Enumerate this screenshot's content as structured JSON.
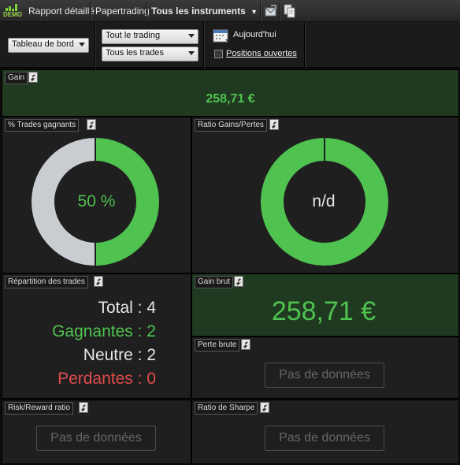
{
  "topbar": {
    "logo_text": "DEMO",
    "report_label": "Rapport détaillé",
    "account_label": "Papertrading",
    "instruments_label": "Tous les instruments"
  },
  "filters": {
    "dashboard_select": "Tableau de bord",
    "trading_select": "Tout le trading",
    "trades_select": "Tous les trades",
    "date_label": "Aujourd'hui",
    "open_positions_label": "Positions ouvertes",
    "open_positions_checked": false
  },
  "panels": {
    "gain": {
      "title": "Gain",
      "value": "258,71 €"
    },
    "win_pct": {
      "title": "% Trades gagnants",
      "value": "50 %",
      "fraction": 0.5
    },
    "ratio": {
      "title": "Ratio Gains/Pertes",
      "value": "n/d"
    },
    "breakdown": {
      "title": "Répartition des trades",
      "total": "Total : 4",
      "winners": "Gagnantes : 2",
      "neutral": "Neutre : 2",
      "losers": "Perdantes : 0"
    },
    "gross_gain": {
      "title": "Gain brut",
      "value": "258,71 €"
    },
    "gross_loss": {
      "title": "Perte brute",
      "value": "Pas de données"
    },
    "risk_reward": {
      "title": "Risk/Reward ratio",
      "value": "Pas de données"
    },
    "sharpe": {
      "title": "Ratio de Sharpe",
      "value": "Pas de données"
    }
  },
  "colors": {
    "green": "#4fc24f",
    "red": "#e04b4b",
    "grey_ring": "#c9cdd1",
    "text_light": "#e6e6e6"
  }
}
